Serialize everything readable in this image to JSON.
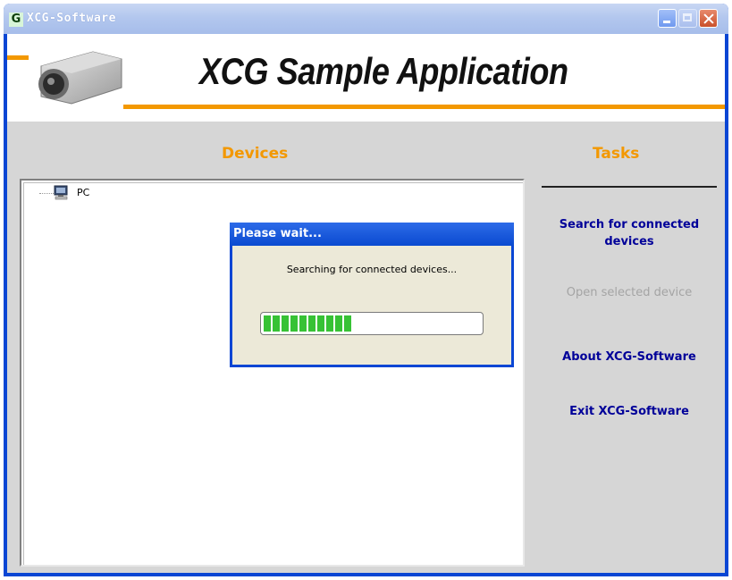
{
  "window": {
    "app_icon": "G",
    "title": "XCG-Software"
  },
  "banner": {
    "title": "XCG Sample Application",
    "logo": "camera-image"
  },
  "devices": {
    "heading": "Devices",
    "tree": [
      {
        "label": "PC",
        "icon": "computer-icon"
      }
    ]
  },
  "tasks": {
    "heading": "Tasks",
    "items": [
      {
        "label": "Search for connected devices",
        "enabled": true
      },
      {
        "label": "Open selected device",
        "enabled": false
      },
      {
        "label": "About XCG-Software",
        "enabled": true
      },
      {
        "label": "Exit XCG-Software",
        "enabled": true
      }
    ]
  },
  "dialog": {
    "title": "Please wait...",
    "message": "Searching for connected devices...",
    "progress": 0.43
  },
  "colors": {
    "accent": "#f39800",
    "link": "#000099",
    "progress": "#37c235"
  }
}
